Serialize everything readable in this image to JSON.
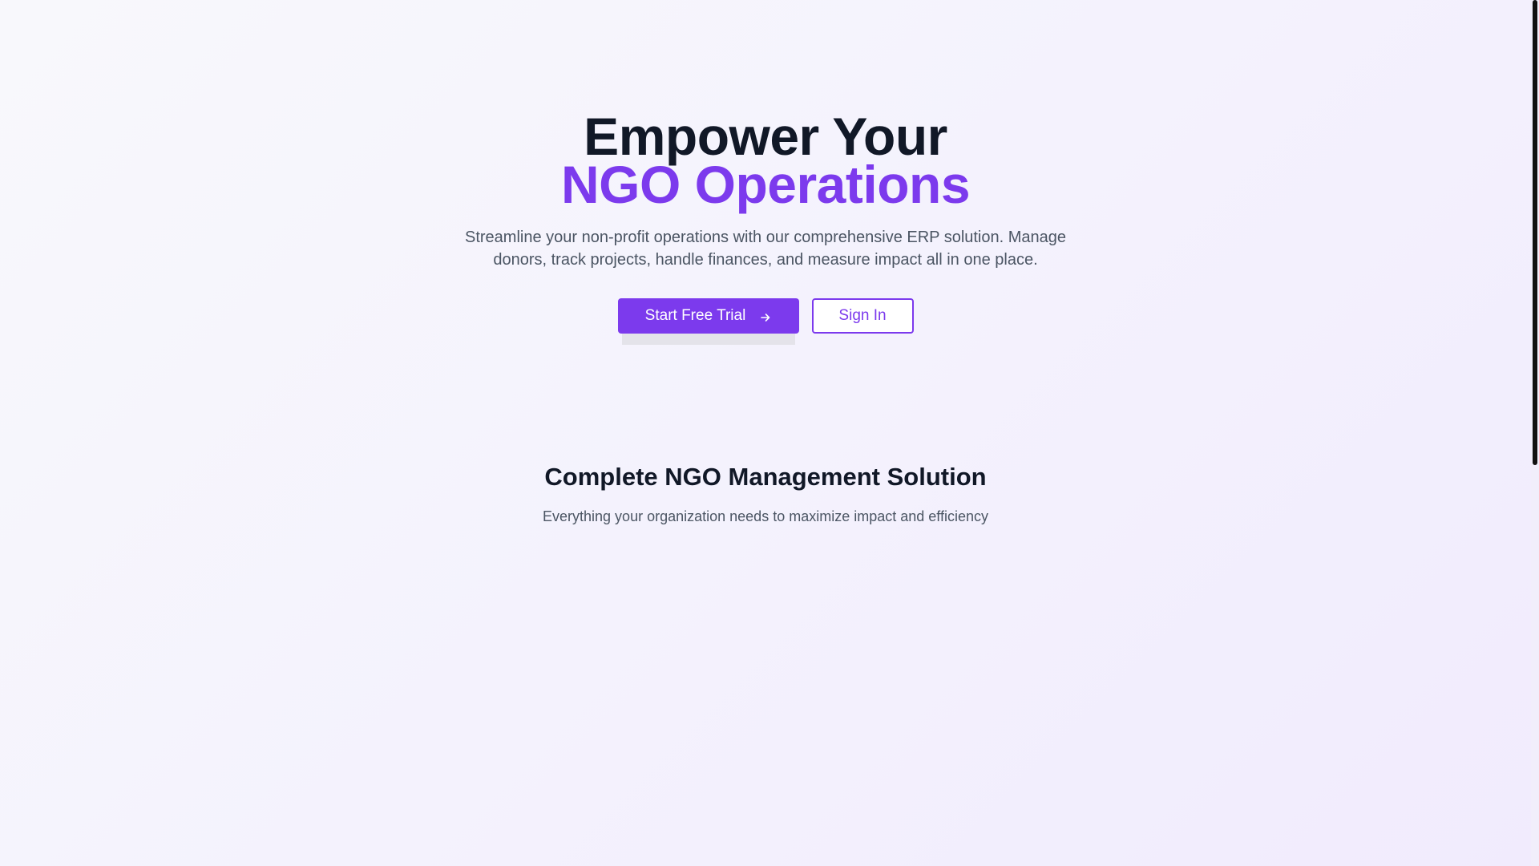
{
  "hero": {
    "title_line1": "Empower Your",
    "title_line2": "NGO Operations",
    "subtitle": "Streamline your non-profit operations with our comprehensive ERP solution. Manage donors, track projects, handle finances, and measure impact all in one place.",
    "primary_button_label": "Start Free Trial",
    "primary_button_icon": "arrow-right-icon",
    "secondary_button_label": "Sign In"
  },
  "features": {
    "title": "Complete NGO Management Solution",
    "subtitle": "Everything your organization needs to maximize impact and efficiency"
  },
  "colors": {
    "accent": "#7c3aed",
    "heading": "#111827",
    "body_text": "#4b5563",
    "background": "#f5f3fd"
  }
}
